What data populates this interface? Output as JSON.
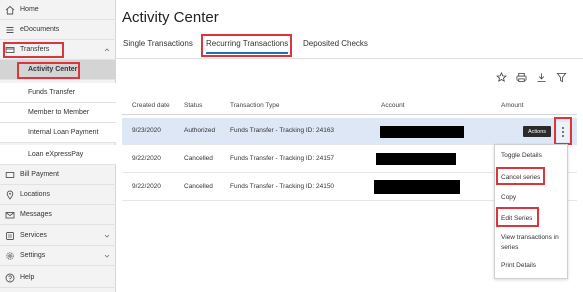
{
  "sidebar": {
    "items": [
      {
        "label": "Home",
        "icon": "home-icon",
        "chevron": false
      },
      {
        "label": "eDocuments",
        "icon": "menu-lines-icon",
        "chevron": false
      },
      {
        "label": "Transfers",
        "icon": "transfer-card-icon",
        "chevron": true
      },
      {
        "label": "Bill Payment",
        "icon": "bill-icon",
        "chevron": false
      },
      {
        "label": "Locations",
        "icon": "location-pin-icon",
        "chevron": false
      },
      {
        "label": "Messages",
        "icon": "envelope-icon",
        "chevron": false
      },
      {
        "label": "Services",
        "icon": "services-icon",
        "chevron": true
      },
      {
        "label": "Settings",
        "icon": "gear-icon",
        "chevron": true
      },
      {
        "label": "Help",
        "icon": "question-icon",
        "chevron": false
      }
    ],
    "transfer_subitems": [
      {
        "label": "Activity Center"
      },
      {
        "label": "Funds Transfer"
      },
      {
        "label": "Member to Member"
      },
      {
        "label": "Internal Loan Payment"
      },
      {
        "label": "Loan eXpressPay"
      }
    ]
  },
  "page": {
    "title": "Activity Center"
  },
  "tabs": [
    {
      "label": "Single Transactions"
    },
    {
      "label": "Recurring Transactions"
    },
    {
      "label": "Deposited Checks"
    }
  ],
  "toolbar": {
    "icons": [
      "star-icon",
      "print-icon",
      "download-icon",
      "filter-icon"
    ]
  },
  "table": {
    "headers": [
      "Created date",
      "Status",
      "Transaction Type",
      "Account",
      "Amount"
    ],
    "rows": [
      {
        "date": "9/23/2020",
        "status": "Authorized",
        "type": "Funds Transfer - Tracking ID: 24163"
      },
      {
        "date": "9/22/2020",
        "status": "Cancelled",
        "type": "Funds Transfer - Tracking ID: 24157"
      },
      {
        "date": "9/22/2020",
        "status": "Cancelled",
        "type": "Funds Transfer - Tracking ID: 24150"
      }
    ]
  },
  "actions": {
    "tooltip": "Actions",
    "menu": [
      "Toggle Details",
      "Cancel series",
      "Copy",
      "Edit Series",
      "View transactions in series",
      "Print Details"
    ]
  },
  "colors": {
    "annotation_red": "#d9363e",
    "active_tab": "#2b6cb0",
    "row_highlight": "#dde7f5"
  }
}
